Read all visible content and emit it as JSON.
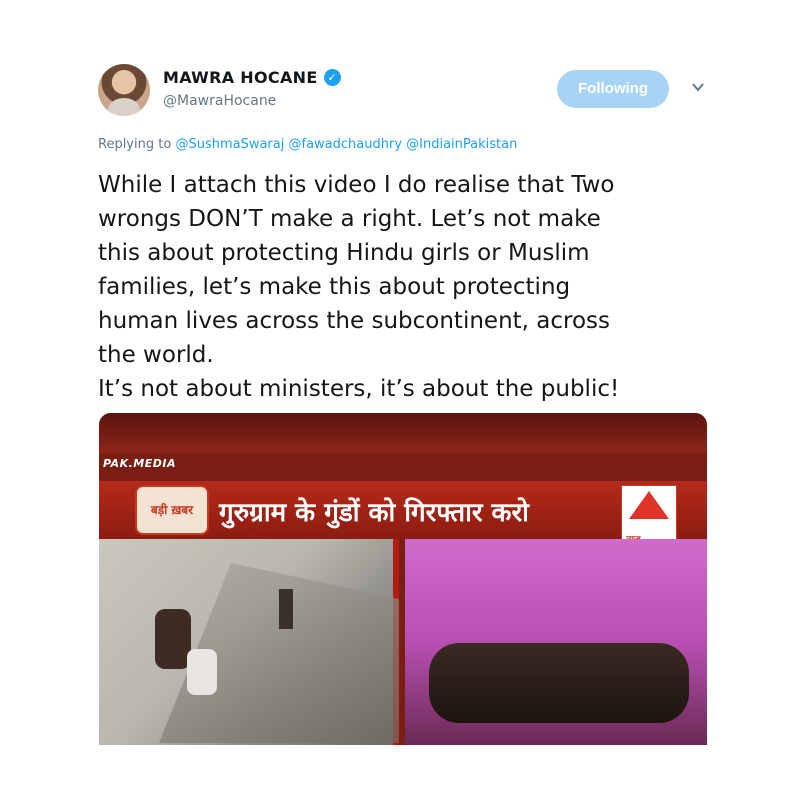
{
  "user": {
    "display_name": "MAWRA HOCANE",
    "verified_mark": "✓",
    "handle": "@MawraHocane",
    "avatar_icon": "avatar-photo"
  },
  "follow": {
    "label": "Following"
  },
  "menu": {
    "icon": "chevron-down-icon"
  },
  "reply": {
    "prefix": "Replying to",
    "mentions": [
      "@SushmaSwaraj",
      "@fawadchaudhry",
      "@IndiainPakistan"
    ]
  },
  "tweet": {
    "text": "While I attach this video I do realise that Two\nwrongs DON’T make a right. Let’s not make\nthis about protecting Hindu girls or Muslim\nfamilies, let’s make this about protecting\nhuman lives across the subcontinent, across\nthe world.\nIt’s not about ministers, it’s about the public!"
  },
  "media": {
    "brand": "PAK.MEDIA",
    "badge": "बड़ी ख़बर",
    "headline": "गुरुग्राम के गुंडों को गिरफ्तार करो",
    "logo_label": "न्यूज़"
  },
  "colors": {
    "accent": "#1da1f2",
    "follow_bg": "#a8d3f4",
    "text": "#14171a",
    "muted": "#657786",
    "media_red": "#b52a1a"
  }
}
